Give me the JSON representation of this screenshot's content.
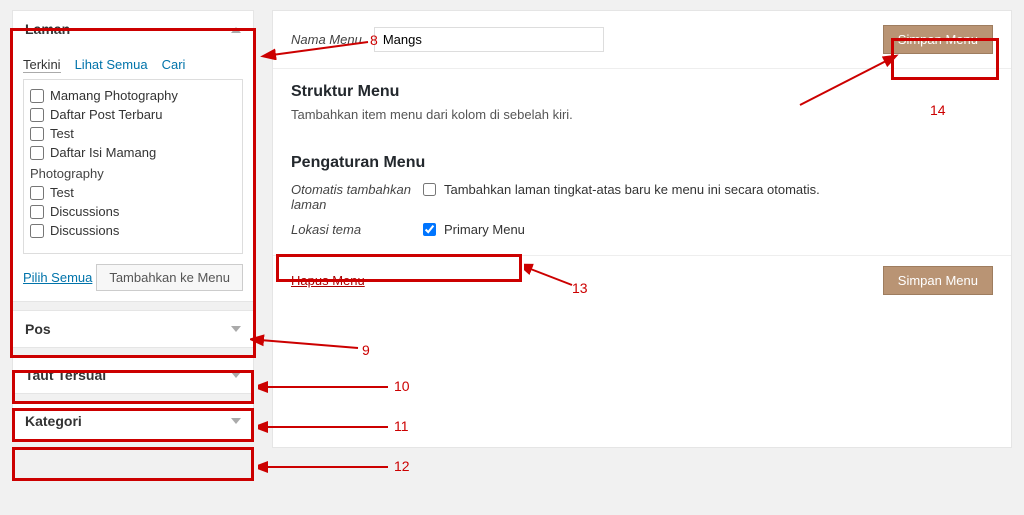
{
  "sidebar": {
    "laman": {
      "title": "Laman",
      "tabs": {
        "terkini": "Terkini",
        "lihat_semua": "Lihat Semua",
        "cari": "Cari"
      },
      "items": [
        {
          "label": "Mamang Photography"
        },
        {
          "label": "Daftar Post Terbaru"
        },
        {
          "label": "Test"
        },
        {
          "label": "Daftar Isi Mamang"
        }
      ],
      "subtitle": "Photography",
      "items2": [
        {
          "label": "Test"
        },
        {
          "label": "Discussions"
        },
        {
          "label": "Discussions"
        }
      ],
      "select_all": "Pilih Semua",
      "add_btn": "Tambahkan ke Menu"
    },
    "pos": {
      "title": "Pos"
    },
    "taut": {
      "title": "Taut Tersuai"
    },
    "kategori": {
      "title": "Kategori"
    }
  },
  "main": {
    "menu_name_label": "Nama Menu",
    "menu_name_value": "Mangs",
    "save_btn": "Simpan Menu",
    "struktur": {
      "title": "Struktur Menu",
      "desc": "Tambahkan item menu dari kolom di sebelah kiri."
    },
    "pengaturan": {
      "title": "Pengaturan Menu",
      "auto_label": "Otomatis tambahkan laman",
      "auto_desc": "Tambahkan laman tingkat-atas baru ke menu ini secara otomatis.",
      "lokasi_label": "Lokasi tema",
      "lokasi_option": "Primary Menu"
    },
    "delete": "Hapus Menu"
  },
  "annotations": {
    "n8": "8",
    "n9": "9",
    "n10": "10",
    "n11": "11",
    "n12": "12",
    "n13": "13",
    "n14": "14"
  }
}
